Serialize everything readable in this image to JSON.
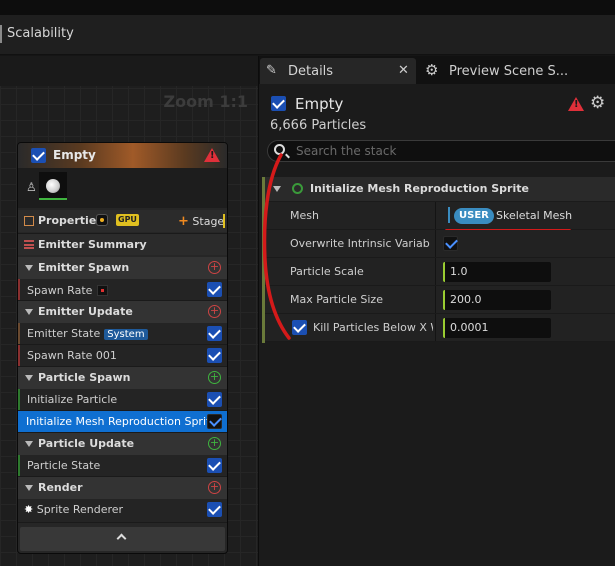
{
  "toolbar": {
    "scalability_label": "Scalability"
  },
  "graph": {
    "zoom_label": "Zoom 1:1"
  },
  "emitter_node": {
    "title": "Empty",
    "properties_label": "Properties",
    "gpu_label": "GPU",
    "stage_label": "Stage",
    "summary_label": "Emitter Summary",
    "sections": {
      "emitter_spawn": "Emitter Spawn",
      "emitter_update": "Emitter Update",
      "particle_spawn": "Particle Spawn",
      "particle_update": "Particle Update",
      "render": "Render"
    },
    "items": {
      "spawn_rate": "Spawn Rate",
      "emitter_state": "Emitter State",
      "system_badge": "System",
      "spawn_rate_001": "Spawn Rate 001",
      "initialize_particle": "Initialize Particle",
      "initialize_mesh_sprite": "Initialize Mesh Reproduction Sprite",
      "particle_state": "Particle State",
      "sprite_renderer": "Sprite Renderer"
    }
  },
  "details": {
    "tab_details": "Details",
    "tab_preview": "Preview Scene S...",
    "emitter_name": "Empty",
    "particle_count": "6,666 Particles",
    "search_placeholder": "Search the stack",
    "group_title": "Initialize Mesh Reproduction Sprite",
    "props": {
      "mesh_label": "Mesh",
      "mesh_badge": "USER",
      "mesh_value": "Skeletal Mesh",
      "overwrite_label": "Overwrite Intrinsic Variables",
      "particle_scale_label": "Particle Scale",
      "particle_scale_value": "1.0",
      "max_particle_size_label": "Max Particle Size",
      "max_particle_size_value": "200.0",
      "kill_particles_label": "Kill Particles Below X W",
      "kill_particles_value": "0.0001"
    }
  },
  "colors": {
    "accent_blue": "#1b4fb3",
    "selected_row": "#0f6fd1",
    "warning_red": "#e0303a",
    "annotation_red": "#d41a1a",
    "user_badge": "#3a8cc0"
  }
}
